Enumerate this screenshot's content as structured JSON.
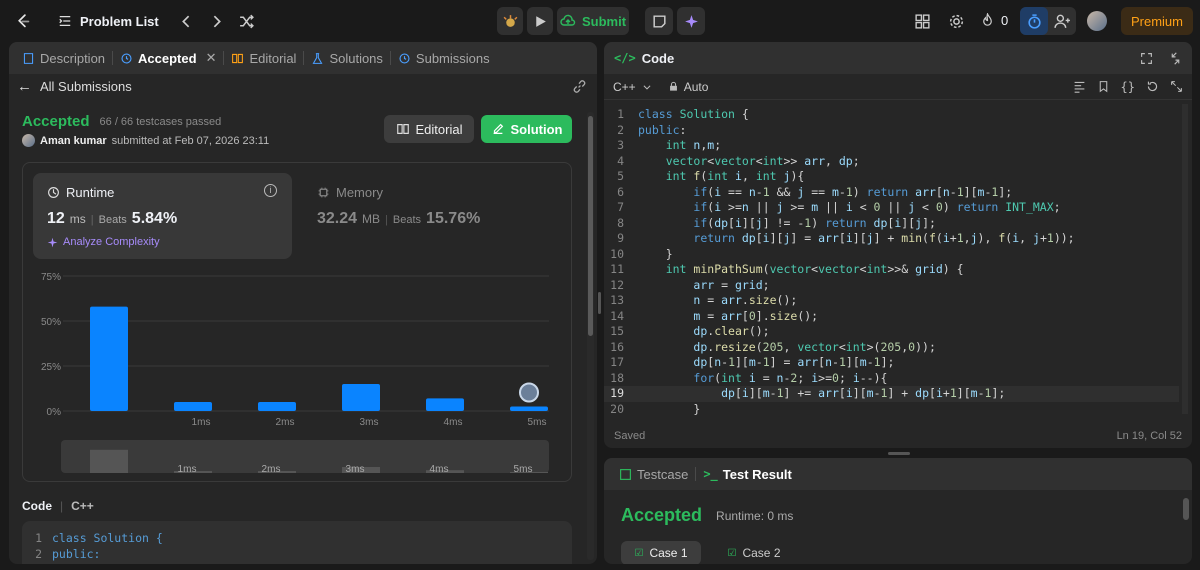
{
  "header": {
    "title": "Problem List",
    "submit_label": "Submit",
    "streak": "0",
    "premium_label": "Premium"
  },
  "left": {
    "tabs": [
      "Description",
      "Accepted",
      "Editorial",
      "Solutions",
      "Submissions"
    ],
    "back_label": "All Submissions",
    "status": "Accepted",
    "testcases": "66 / 66 testcases passed",
    "user": "Aman kumar",
    "submitted_text": "submitted at Feb 07, 2026 23:11",
    "editorial_btn": "Editorial",
    "solution_btn": "Solution",
    "runtime": {
      "title": "Runtime",
      "value": "12",
      "unit": "ms",
      "beats_label": "Beats",
      "beats": "5.84%",
      "analyze": "Analyze Complexity"
    },
    "memory": {
      "title": "Memory",
      "value": "32.24",
      "unit": "MB",
      "beats_label": "Beats",
      "beats": "15.76%"
    },
    "code_label": "Code",
    "lang": "C++",
    "snippet": [
      "class Solution {",
      "public:"
    ]
  },
  "chart_data": {
    "type": "bar",
    "categories": [
      "",
      "1ms",
      "2ms",
      "3ms",
      "4ms",
      "5ms"
    ],
    "values": [
      58,
      5,
      5,
      15,
      7,
      2.5
    ],
    "yticks": [
      "75%",
      "50%",
      "25%",
      "0%"
    ],
    "ylim": [
      0,
      75
    ],
    "bar_color": "#0a84ff",
    "mini_categories": [
      "",
      "1ms",
      "2ms",
      "3ms",
      "4ms",
      "5ms"
    ]
  },
  "editor": {
    "title": "Code",
    "lang": "C++",
    "mode": "Auto",
    "status": "Saved",
    "cursor": "Ln 19, Col 52",
    "lines": [
      "class Solution {",
      "public:",
      "    int n,m;",
      "    vector<vector<int>> arr, dp;",
      "    int f(int i, int j){",
      "        if(i == n-1 && j == m-1) return arr[n-1][m-1];",
      "        if(i >=n || j >= m || i < 0 || j < 0) return INT_MAX;",
      "        if(dp[i][j] != -1) return dp[i][j];",
      "        return dp[i][j] = arr[i][j] + min(f(i+1,j), f(i, j+1));",
      "    }",
      "    int minPathSum(vector<vector<int>>& grid) {",
      "        arr = grid;",
      "        n = arr.size();",
      "        m = arr[0].size();",
      "        dp.clear();",
      "        dp.resize(205, vector<int>(205,0));",
      "        dp[n-1][m-1] = arr[n-1][m-1];",
      "        for(int i = n-2; i>=0; i--){",
      "            dp[i][m-1] += arr[i][m-1] + dp[i+1][m-1];",
      "        }"
    ]
  },
  "result": {
    "tab1": "Testcase",
    "tab2": "Test Result",
    "status": "Accepted",
    "runtime": "Runtime: 0 ms",
    "case1": "Case 1",
    "case2": "Case 2"
  }
}
